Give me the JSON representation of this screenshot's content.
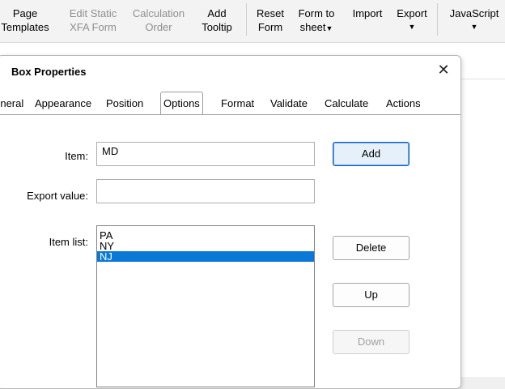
{
  "ribbon": {
    "items": [
      {
        "line1": "Page",
        "line2": "Templates",
        "disabled": false
      },
      {
        "line1": "Edit Static",
        "line2": "XFA Form",
        "disabled": true
      },
      {
        "line1": "Calculation",
        "line2": "Order",
        "disabled": true
      },
      {
        "line1": "Add",
        "line2": "Tooltip",
        "disabled": false
      },
      {
        "line1": "Reset",
        "line2": "Form",
        "disabled": false
      },
      {
        "line1": "Form to",
        "line2": "sheet",
        "disabled": false
      },
      {
        "line1": "Import",
        "line2": "",
        "disabled": false
      },
      {
        "line1": "Export",
        "line2": "",
        "disabled": false
      },
      {
        "line1": "JavaScript",
        "line2": "",
        "disabled": false
      }
    ]
  },
  "dialog": {
    "title": "Box Properties",
    "tabs": [
      "General",
      "Appearance",
      "Position",
      "Options",
      "Format",
      "Validate",
      "Calculate",
      "Actions"
    ],
    "active_tab": "Options",
    "item_label": "Item:",
    "item_value": "MD",
    "export_label": "Export value:",
    "export_value": "",
    "item_list_label": "Item list:",
    "item_list": [
      "PA",
      "NY",
      "NJ"
    ],
    "selected_item": "NJ",
    "buttons": {
      "add": "Add",
      "delete": "Delete",
      "up": "Up",
      "down": "Down"
    }
  }
}
